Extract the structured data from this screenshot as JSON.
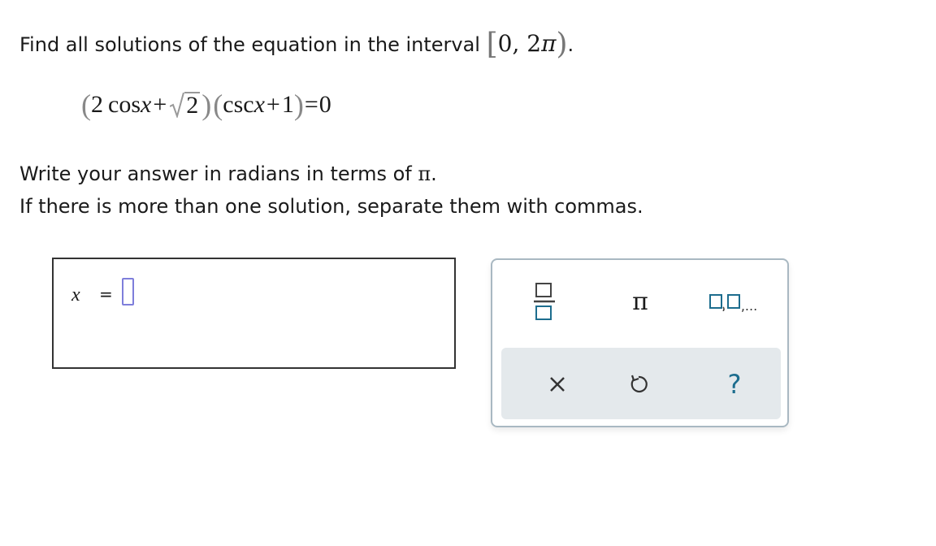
{
  "question": {
    "prompt_prefix": "Find all solutions of the equation in the interval",
    "interval_open": "[",
    "interval_values": "0,  2",
    "interval_pi": "π",
    "interval_close": ")",
    "prompt_suffix": "."
  },
  "equation": {
    "open1": "(",
    "coef": "2",
    "func1": "cos",
    "var1": "x",
    "plus1": "+",
    "radicand": "2",
    "close1": ")",
    "open2": "(",
    "func2": "csc",
    "var2": "x",
    "plus2": "+",
    "one": "1",
    "close2": ")",
    "equals": "=",
    "rhs": "0"
  },
  "instructions": {
    "line1_prefix": "Write your answer in radians in terms of",
    "line1_pi": "π",
    "line1_suffix": ".",
    "line2": "If there is more than one solution, separate them with commas."
  },
  "answer": {
    "variable": "x",
    "equals": "=",
    "value": ""
  },
  "palette": {
    "pi_symbol": "π",
    "list_suffix": ",...",
    "help_symbol": "?",
    "icons": [
      "fraction-icon",
      "list-icon",
      "clear-icon",
      "undo-icon",
      "help-icon"
    ],
    "accent_color": "#1d6d8e"
  }
}
